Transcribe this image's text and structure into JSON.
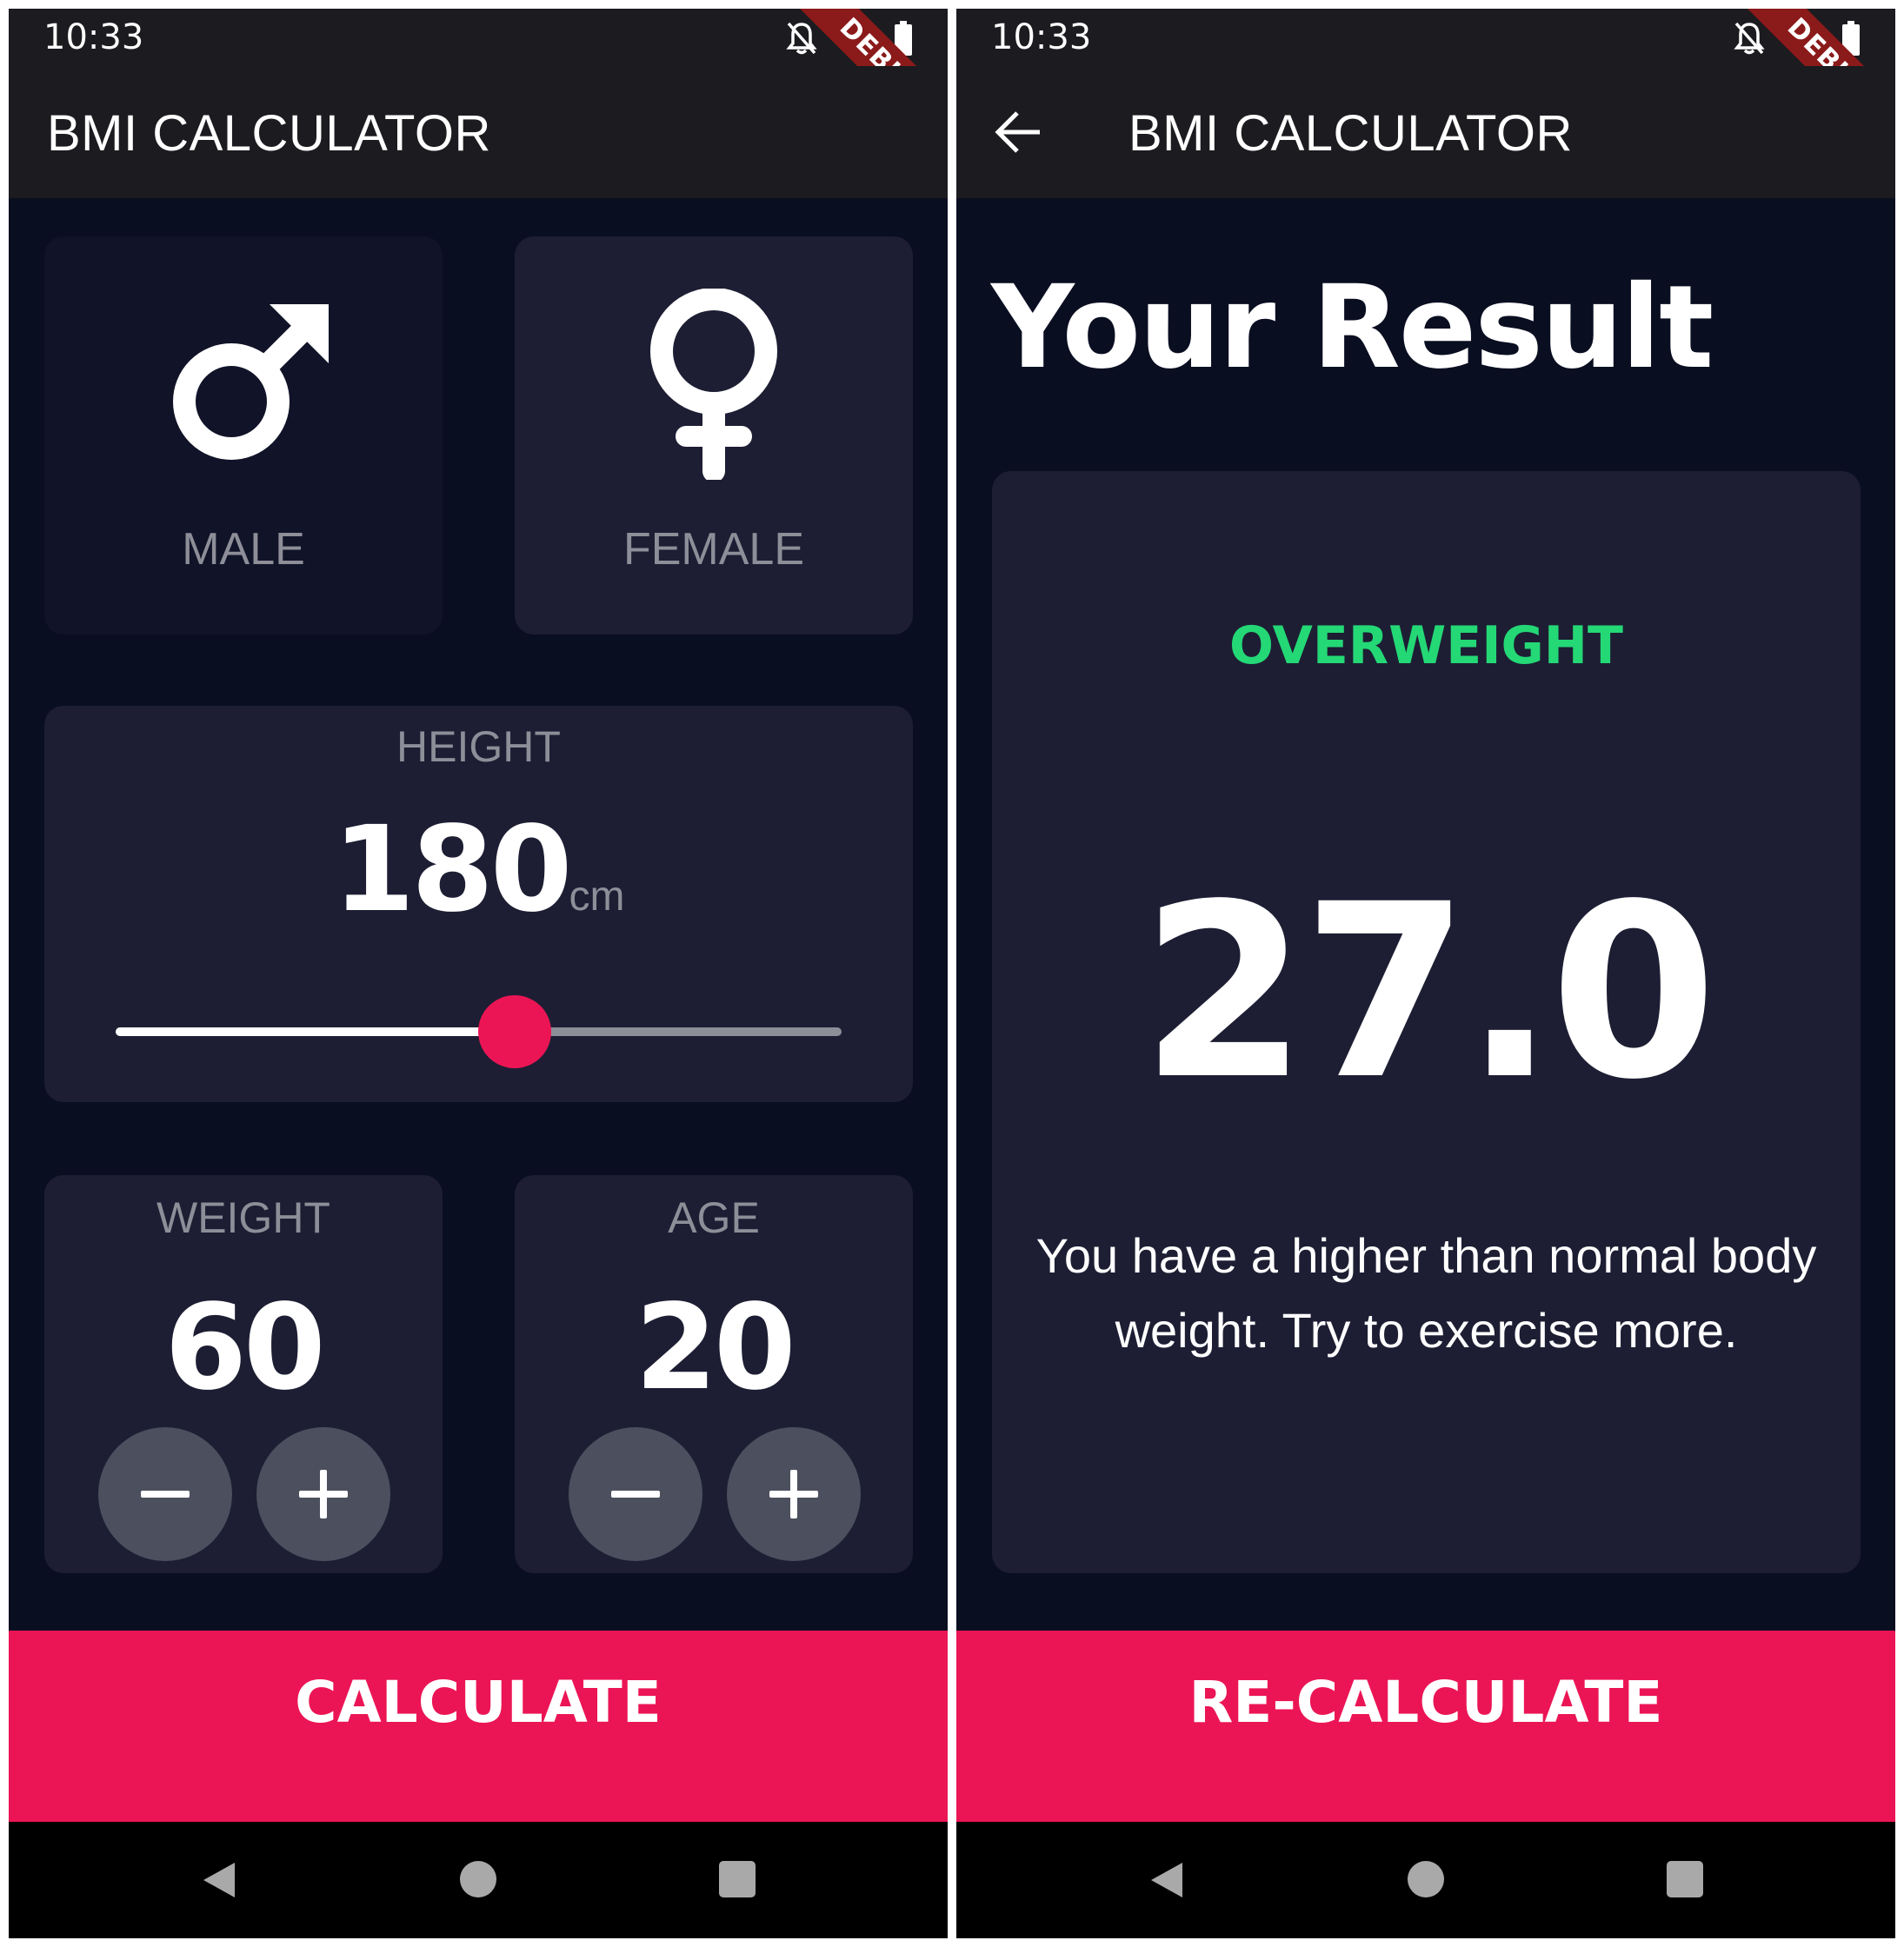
{
  "status_bar": {
    "time": "10:33"
  },
  "debug_label": "DEBUG",
  "app_title": "BMI CALCULATOR",
  "colors": {
    "accent": "#eb1555",
    "card": "#1d1e33",
    "background": "#0a0e21",
    "result_status": "#24d876"
  },
  "input_screen": {
    "gender": {
      "male": {
        "label": "MALE",
        "icon": "male-symbol-icon"
      },
      "female": {
        "label": "FEMALE",
        "icon": "female-symbol-icon"
      }
    },
    "height": {
      "label": "HEIGHT",
      "value": "180",
      "unit": "cm",
      "slider_fraction": 0.55
    },
    "weight": {
      "label": "WEIGHT",
      "value": "60"
    },
    "age": {
      "label": "AGE",
      "value": "20"
    },
    "calculate_label": "CALCULATE"
  },
  "result_screen": {
    "heading": "Your Result",
    "status": "OVERWEIGHT",
    "bmi": "27.0",
    "interpretation": "You have a higher than normal body weight. Try to exercise more.",
    "recalculate_label": "RE-CALCULATE"
  }
}
